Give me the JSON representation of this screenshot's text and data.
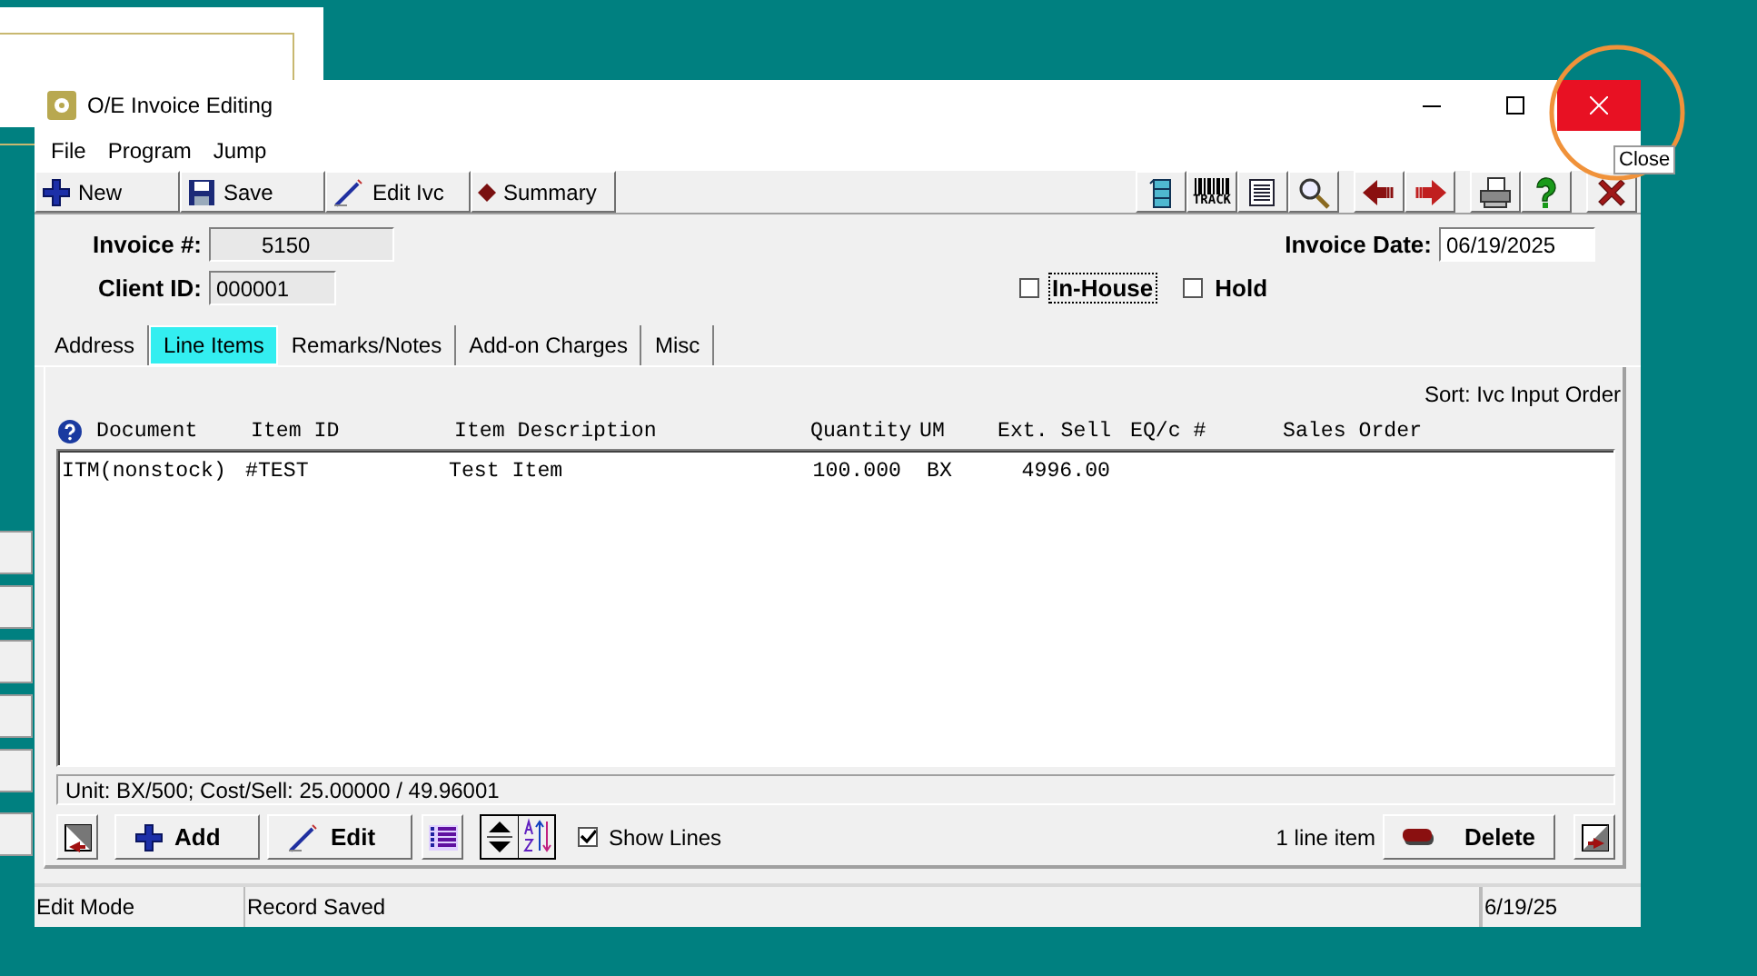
{
  "window": {
    "title": "O/E Invoice Editing",
    "tooltip": "Close"
  },
  "menu": [
    "File",
    "Program",
    "Jump"
  ],
  "toolbar": {
    "buttons": [
      {
        "label": "New"
      },
      {
        "label": "Save"
      },
      {
        "label": "Edit Ivc"
      },
      {
        "label": "Summary"
      }
    ],
    "icon_buttons": [
      {
        "kind": "cabinet"
      },
      {
        "kind": "track",
        "label": "TRACK"
      },
      {
        "kind": "document"
      },
      {
        "kind": "search"
      },
      {
        "kind": "previous"
      },
      {
        "kind": "next"
      },
      {
        "kind": "print"
      },
      {
        "kind": "help"
      },
      {
        "kind": "exit"
      }
    ]
  },
  "header": {
    "invoice_label": "Invoice #:",
    "invoice_value": "5150",
    "client_label": "Client ID:",
    "client_value": "000001",
    "date_label": "Invoice Date:",
    "date_value": "06/19/2025",
    "checks": [
      {
        "label": "In-House",
        "checked": false,
        "focused": true
      },
      {
        "label": "Hold",
        "checked": false,
        "focused": false
      }
    ]
  },
  "tabs": [
    {
      "label": "Address",
      "selected": false
    },
    {
      "label": "Line Items",
      "selected": true
    },
    {
      "label": "Remarks/Notes",
      "selected": false
    },
    {
      "label": "Add-on Charges",
      "selected": false
    },
    {
      "label": "Misc",
      "selected": false
    }
  ],
  "sort": "Sort: Ivc Input Order",
  "table": {
    "columns": [
      "Document",
      "Item ID",
      "Item Description",
      "Quantity",
      "UM",
      "Ext. Sell",
      "EQ/c #",
      "Sales Order"
    ],
    "rows": [
      {
        "document": "ITM(nonstock)",
        "item_id": "#TEST",
        "description": "Test Item",
        "quantity": "100.000",
        "um": "BX",
        "ext_sell": "4996.00"
      }
    ]
  },
  "info_line": "Unit: BX/500; Cost/Sell: 25.00000 / 49.96001",
  "bottom": {
    "add": "Add",
    "edit": "Edit",
    "show_lines": {
      "label": "Show Lines",
      "checked": true
    },
    "count": "1 line item",
    "delete": "Delete"
  },
  "status_bar": [
    "Edit Mode",
    "Record Saved",
    "6/19/25"
  ]
}
